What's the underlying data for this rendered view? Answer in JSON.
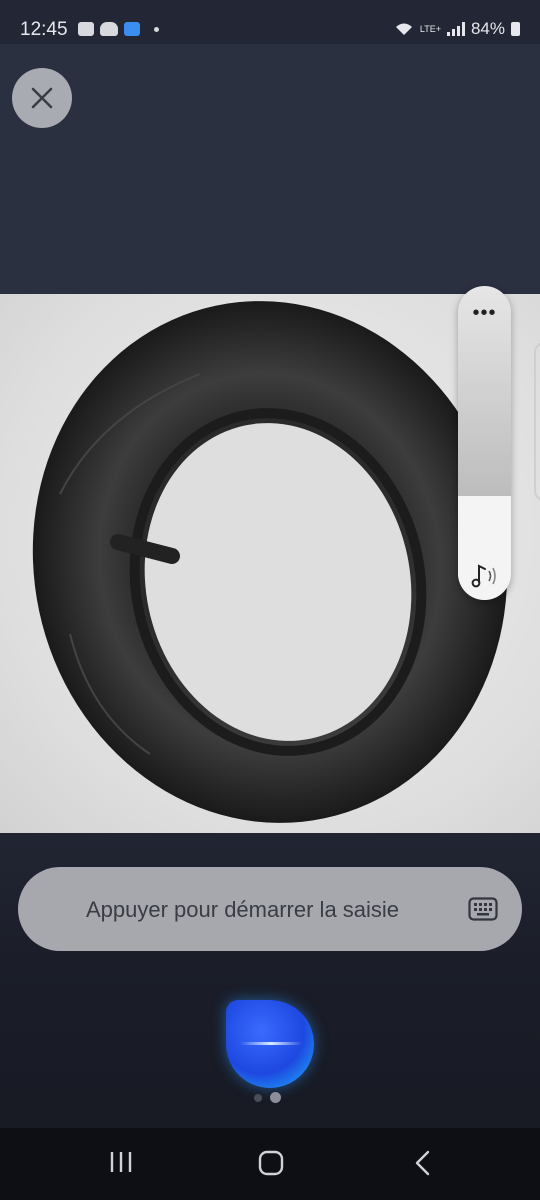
{
  "status_bar": {
    "time": "12:45",
    "network": "LTE+",
    "battery": "84%"
  },
  "input_bar": {
    "placeholder": "Appuyer pour démarrer la saisie"
  },
  "volume_slider": {
    "level": 0.33,
    "more_label": "•••"
  },
  "pager": {
    "count": 2,
    "active": 2
  },
  "icons": {
    "close": "close-icon",
    "keyboard": "keyboard-icon",
    "music": "music-note-icon",
    "recents": "recents-icon",
    "home": "home-icon",
    "back": "back-icon"
  },
  "colors": {
    "background": "#2b3041",
    "input_bar": "#a6a8ae",
    "orb_blue": "#1e48e0",
    "orb_cyan": "#1fb6ff"
  }
}
